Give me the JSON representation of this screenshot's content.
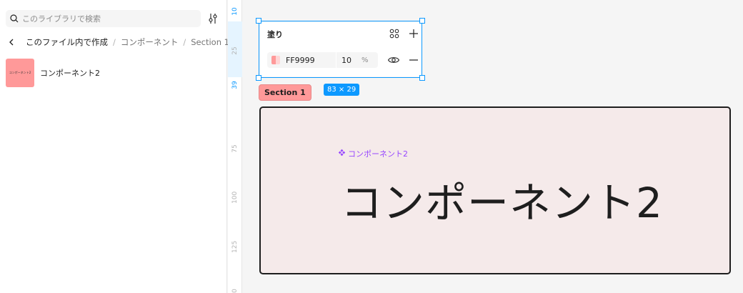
{
  "sidebar": {
    "search": {
      "placeholder": "このライブラリで検索",
      "icon": "search-icon"
    },
    "filter_icon": "adjust-icon",
    "breadcrumb": {
      "current": "このファイル内で作成",
      "separator": "/",
      "items": [
        "コンポーネント",
        "Section 1"
      ]
    },
    "components": [
      {
        "name": "コンポーネント2",
        "thumb_color": "#ff9999",
        "thumb_text": "コンポーネント2"
      }
    ]
  },
  "ruler": {
    "ticks": [
      "10",
      "25",
      "39",
      "75",
      "100",
      "125",
      "0"
    ]
  },
  "fill_panel": {
    "title": "塗り",
    "hex": "FF9999",
    "opacity": "10",
    "percent_symbol": "%",
    "color": "#ff9999"
  },
  "selection": {
    "size_label": "83 × 29"
  },
  "section": {
    "tag": "Section 1",
    "component_label": "コンポーネント2",
    "component_text": "コンポーネント2",
    "bg_color": "#f5eaea",
    "label_color": "#9747ff"
  },
  "colors": {
    "accent": "#0d99ff",
    "component_purple": "#9747ff",
    "section_red": "#ff9999"
  }
}
